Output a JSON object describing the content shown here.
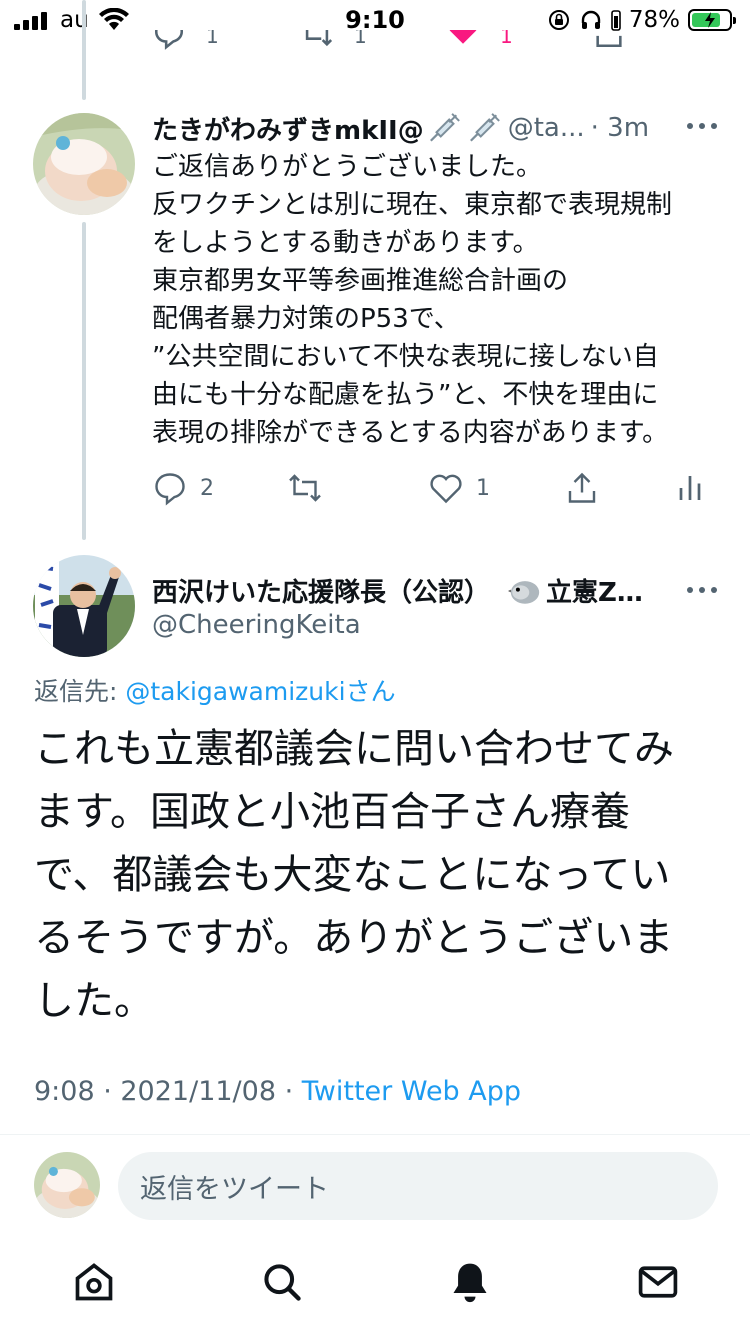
{
  "status_bar": {
    "carrier": "au",
    "time": "9:10",
    "battery_percent": "78%",
    "battery_level": 0.78
  },
  "tweet_top": {
    "user": {
      "name": "たきがわみずきmkII@",
      "handle": "@ta...",
      "time": "· 3m"
    },
    "lines": [
      "ご返信ありがとうございました。",
      "反ワクチンとは別に現在、東京都で表現規制",
      "をしようとする動きがあります。",
      "東京都男女平等参画推進総合計画の",
      "配偶者暴力対策のP53で、",
      "”公共空間において不快な表現に接しない自",
      "由にも十分な配慮を払う”と、不快を理由に",
      "表現の排除ができるとする内容があります。"
    ],
    "reply_count": "2",
    "retweet_count": "",
    "like_count": "1"
  },
  "tweet_main": {
    "user": {
      "name": "西沢けいた応援隊長（公認）",
      "name_suffix": "立憲Z…",
      "handle": "@CheeringKeita"
    },
    "reply_to_label": "返信先: ",
    "reply_to_handle": "@takigawamizukiさん",
    "lines": [
      "これも立憲都議会に問い合わせてみ",
      "ます。国政と小池百合子さん療養",
      "で、都議会も大変なことになってい",
      "るそうですが。ありがとうございま",
      "した。"
    ],
    "timestamp": "9:08 · 2021/11/08 · ",
    "source": "Twitter Web App"
  },
  "reply_bar": {
    "placeholder": "返信をツイート"
  },
  "tab_bar": {
    "icons": [
      "home-icon",
      "search-icon",
      "notifications-icon",
      "messages-icon"
    ]
  }
}
